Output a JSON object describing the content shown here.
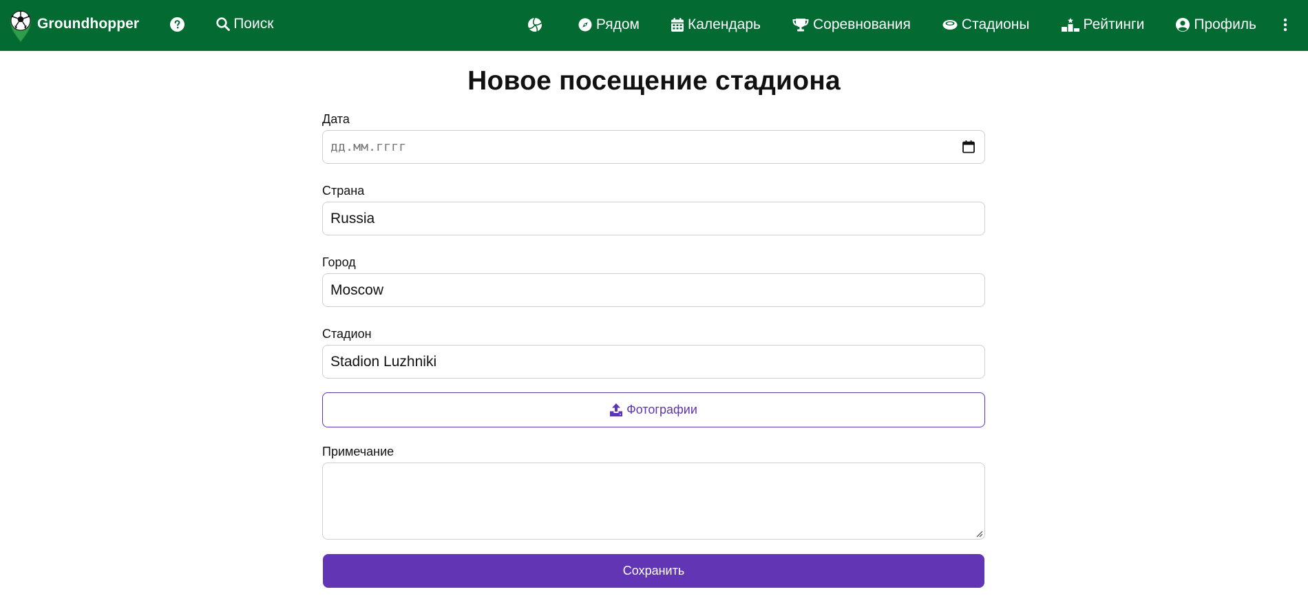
{
  "navbar": {
    "brand": "Groundhopper",
    "search_label": "Поиск",
    "items": [
      {
        "icon": "compass-icon",
        "label": "Рядом"
      },
      {
        "icon": "calendar-icon",
        "label": "Календарь"
      },
      {
        "icon": "trophy-icon",
        "label": "Соревнования"
      },
      {
        "icon": "stadium-icon",
        "label": "Стадионы"
      },
      {
        "icon": "ranking-icon",
        "label": "Рейтинги"
      },
      {
        "icon": "user-circle-icon",
        "label": "Профиль"
      }
    ],
    "bg_color": "#036a31"
  },
  "page": {
    "title": "Новое посещение стадиона"
  },
  "form": {
    "date": {
      "label": "Дата",
      "placeholder": "дд.мм.гггг",
      "value": ""
    },
    "country": {
      "label": "Страна",
      "value": "Russia"
    },
    "city": {
      "label": "Город",
      "value": "Moscow"
    },
    "stadium": {
      "label": "Стадион",
      "value": "Stadion Luzhniki"
    },
    "photos_label": "Фотографии",
    "note": {
      "label": "Примечание",
      "value": ""
    },
    "save_label": "Сохранить"
  },
  "colors": {
    "accent": "#6135b3",
    "outline_accent": "#5e35b1",
    "border": "#cfcfcf"
  }
}
